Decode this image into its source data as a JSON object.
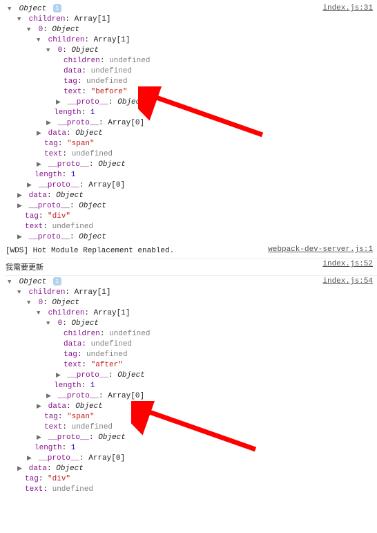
{
  "sources": {
    "s1": "index.js:31",
    "s2": "webpack-dev-server.js:1",
    "s3": "index.js:52",
    "s4": "index.js:54"
  },
  "labels": {
    "object": "Object",
    "children": "children",
    "array1": "Array[1]",
    "array0": "Array[0]",
    "idx0": "0",
    "data": "data",
    "tag": "tag",
    "text": "text",
    "proto": "__proto__",
    "length": "length",
    "undefined": "undefined",
    "before": "\"before\"",
    "after": "\"after\"",
    "span": "\"span\"",
    "div": "\"div\"",
    "one": "1",
    "colon": ": "
  },
  "logs": {
    "wds": "[WDS] Hot Module Replacement enabled.",
    "update": "我需要更新"
  },
  "arrows": {
    "collapsed": "▶",
    "expanded": "▼"
  }
}
